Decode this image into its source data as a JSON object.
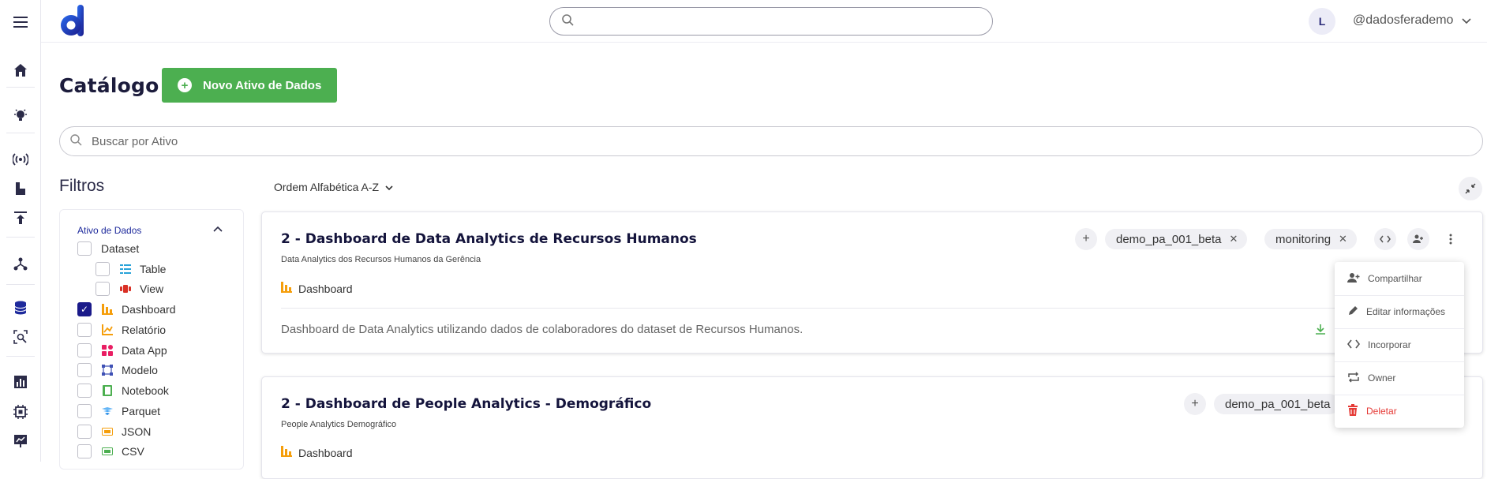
{
  "app": {
    "user_initial": "L",
    "username": "@dadosferademo"
  },
  "page": {
    "title": "Catálogo",
    "new_button_label": "Novo Ativo de Dados",
    "search_placeholder": "Buscar por Ativo"
  },
  "filters": {
    "title": "Filtros",
    "section_title": "Ativo de Dados",
    "items": [
      {
        "label": "Dataset",
        "checked": false,
        "icon": "none"
      },
      {
        "label": "Table",
        "checked": false,
        "icon": "table-icon"
      },
      {
        "label": "View",
        "checked": false,
        "icon": "view-icon"
      },
      {
        "label": "Dashboard",
        "checked": true,
        "icon": "dashboard-icon"
      },
      {
        "label": "Relatório",
        "checked": false,
        "icon": "report-icon"
      },
      {
        "label": "Data App",
        "checked": false,
        "icon": "data-app-icon"
      },
      {
        "label": "Modelo",
        "checked": false,
        "icon": "model-icon"
      },
      {
        "label": "Notebook",
        "checked": false,
        "icon": "notebook-icon"
      },
      {
        "label": "Parquet",
        "checked": false,
        "icon": "parquet-icon"
      },
      {
        "label": "JSON",
        "checked": false,
        "icon": "json-icon"
      },
      {
        "label": "CSV",
        "checked": false,
        "icon": "csv-icon"
      }
    ]
  },
  "sort": {
    "label": "Ordem Alfabética A-Z"
  },
  "cards": [
    {
      "title": "2 - Dashboard de Data Analytics de Recursos Humanos",
      "subtitle": "Data Analytics dos Recursos Humanos da Gerência",
      "type": "Dashboard",
      "description": "Dashboard de Data Analytics utilizando dados de colaboradores do dataset de Recursos Humanos.",
      "tags": [
        "demo_pa_001_beta",
        "monitoring"
      ]
    },
    {
      "title": "2 - Dashboard de People Analytics - Demográfico",
      "subtitle": "People Analytics Demográfico",
      "type": "Dashboard",
      "tags": [
        "demo_pa_001_beta"
      ]
    }
  ],
  "context_menu": {
    "items": [
      {
        "label": "Compartilhar",
        "icon": "share-user-icon"
      },
      {
        "label": "Editar informações",
        "icon": "pencil-icon"
      },
      {
        "label": "Incorporar",
        "icon": "code-icon"
      },
      {
        "label": "Owner",
        "icon": "transfer-icon"
      },
      {
        "label": "Deletar",
        "icon": "trash-icon"
      }
    ]
  },
  "colors": {
    "accent": "#4caf50",
    "primary": "#1a1a8a",
    "danger": "#e53935",
    "dashboard_orange": "#f59e0b"
  }
}
